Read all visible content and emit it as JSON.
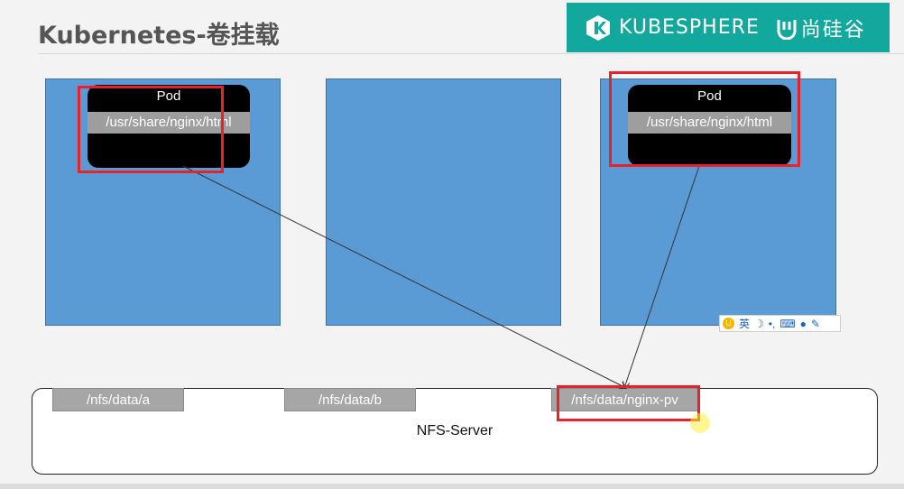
{
  "slide": {
    "title": "Kubernetes-卷挂载"
  },
  "brand": {
    "kubesphere": "KUBESPHERE",
    "atguigu": "尚硅谷",
    "color": "#13a89e"
  },
  "pods": [
    {
      "label": "Pod",
      "mount_path": "/usr/share/nginx/html"
    },
    {
      "label": "Pod",
      "mount_path": "/usr/share/nginx/html"
    }
  ],
  "nfs": {
    "server_label": "NFS-Server",
    "shares": [
      "/nfs/data/a",
      "/nfs/data/b",
      "/nfs/data/nginx-pv"
    ]
  },
  "ime_toolbar": {
    "language": "英",
    "icons": [
      "moon-icon",
      "punctuation-icon",
      "keyboard-icon",
      "user-icon",
      "wrench-icon"
    ]
  },
  "colors": {
    "node_fill": "#5b9bd5",
    "highlight": "#e6232a",
    "share_fill": "#a6a6a6"
  }
}
